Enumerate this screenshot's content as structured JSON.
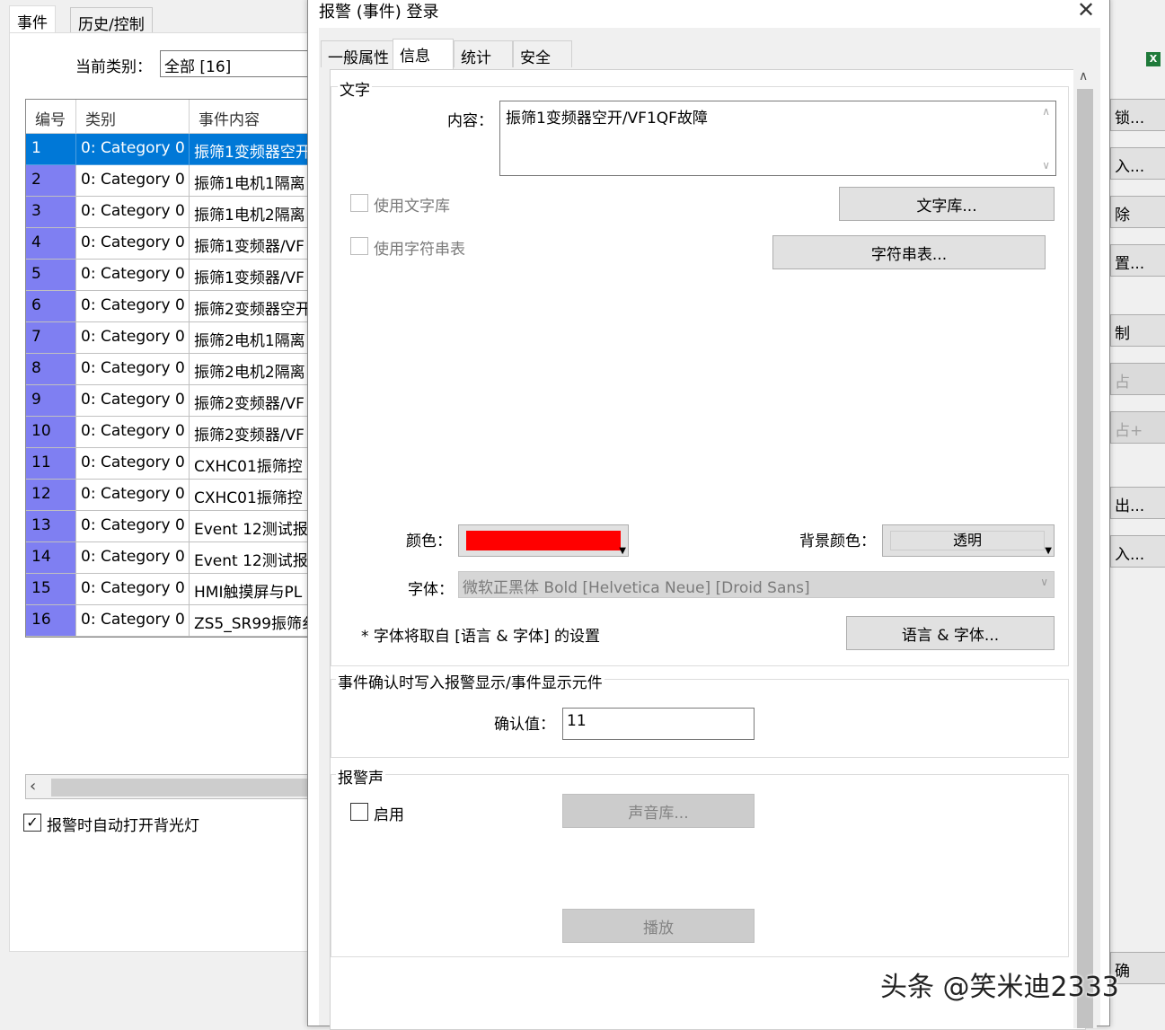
{
  "bg": {
    "tabs": [
      "事件",
      "历史/控制"
    ],
    "category_label": "当前类别：",
    "category_value": "全部 [16]",
    "columns": [
      "编号",
      "类别",
      "事件内容"
    ],
    "rows": [
      {
        "num": "1",
        "cat": "0: Category 0",
        "text": "振筛1变频器空开",
        "selected": true
      },
      {
        "num": "2",
        "cat": "0: Category 0",
        "text": "振筛1电机1隔离"
      },
      {
        "num": "3",
        "cat": "0: Category 0",
        "text": "振筛1电机2隔离"
      },
      {
        "num": "4",
        "cat": "0: Category 0",
        "text": "振筛1变频器/VF"
      },
      {
        "num": "5",
        "cat": "0: Category 0",
        "text": "振筛1变频器/VF"
      },
      {
        "num": "6",
        "cat": "0: Category 0",
        "text": "振筛2变频器空开"
      },
      {
        "num": "7",
        "cat": "0: Category 0",
        "text": "振筛2电机1隔离"
      },
      {
        "num": "8",
        "cat": "0: Category 0",
        "text": "振筛2电机2隔离"
      },
      {
        "num": "9",
        "cat": "0: Category 0",
        "text": "振筛2变频器/VF"
      },
      {
        "num": "10",
        "cat": "0: Category 0",
        "text": "振筛2变频器/VF"
      },
      {
        "num": "11",
        "cat": "0: Category 0",
        "text": "CXHC01振筛控"
      },
      {
        "num": "12",
        "cat": "0: Category 0",
        "text": "CXHC01振筛控"
      },
      {
        "num": "13",
        "cat": "0: Category 0",
        "text": "Event 12测试报"
      },
      {
        "num": "14",
        "cat": "0: Category 0",
        "text": "Event 12测试报"
      },
      {
        "num": "15",
        "cat": "0: Category 0",
        "text": "HMI触摸屏与PL"
      },
      {
        "num": "16",
        "cat": "0: Category 0",
        "text": "ZS5_SR99振筛纟"
      }
    ],
    "backlight_label": "报警时自动打开背光灯",
    "right_buttons": [
      {
        "label": "锁...",
        "disabled": false
      },
      {
        "label": "入...",
        "disabled": false
      },
      {
        "label": "除",
        "disabled": false
      },
      {
        "label": "置...",
        "disabled": false
      },
      {
        "label": "制",
        "disabled": false
      },
      {
        "label": "占",
        "disabled": true
      },
      {
        "label": "占+",
        "disabled": true
      },
      {
        "label": "出...",
        "disabled": false
      },
      {
        "label": "入...",
        "disabled": false
      },
      {
        "label": "确",
        "disabled": false
      }
    ]
  },
  "dialog": {
    "title": "报警 (事件) 登录",
    "tabs": [
      "一般属性",
      "信息",
      "统计",
      "安全"
    ],
    "text_group": "文字",
    "content_label": "内容：",
    "content_value": "振筛1变频器空开/VF1QF故障",
    "use_textlib": "使用文字库",
    "textlib_button": "文字库...",
    "use_stringtable": "使用字符串表",
    "stringtable_button": "字符串表...",
    "color_label": "颜色：",
    "color_value": "#ff0000",
    "bgcolor_label": "背景颜色：",
    "bgcolor_value": "透明",
    "font_label": "字体：",
    "font_value": "微软正黑体 Bold [Helvetica Neue] [Droid Sans]",
    "font_note": "* 字体将取自 [语言 & 字体] 的设置",
    "lang_font_button": "语言 & 字体...",
    "ack_group": "事件确认时写入报警显示/事件显示元件",
    "ack_label": "确认值：",
    "ack_value": "11",
    "sound_group": "报警声",
    "enable_label": "启用",
    "soundlib_button": "声音库...",
    "play_button": "播放"
  },
  "watermark": "头条 @笑米迪2333"
}
